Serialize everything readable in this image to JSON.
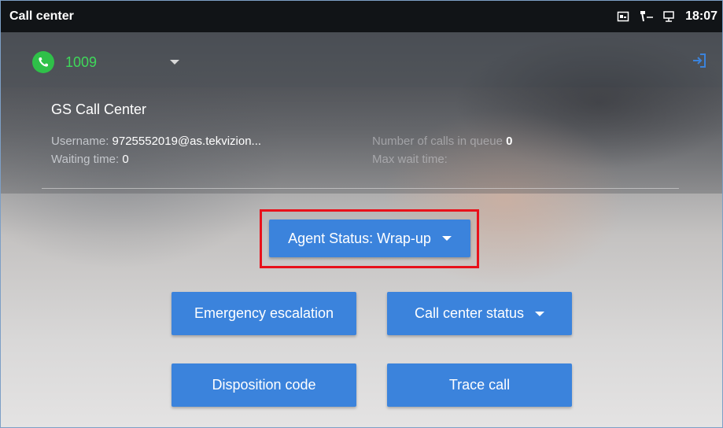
{
  "statusbar": {
    "title": "Call center",
    "time": "18:07",
    "icons": [
      "screenshot-icon",
      "usb-icon",
      "network-icon"
    ]
  },
  "header": {
    "line_number": "1009",
    "icons": [
      "phone-icon",
      "dropdown-icon",
      "exit-icon"
    ]
  },
  "panel": {
    "title": "GS Call Center",
    "username_label": "Username: ",
    "username_value": "9725552019@as.tekvizion...",
    "waiting_label": "Waiting time: ",
    "waiting_value": "0",
    "queue_label": "Number of calls in queue ",
    "queue_value": "0",
    "max_wait_label": "Max wait time:"
  },
  "buttons": {
    "agent_status": "Agent Status: Wrap-up",
    "emergency": "Emergency escalation",
    "call_center_status": "Call center status",
    "disposition": "Disposition code",
    "trace": "Trace call"
  },
  "colors": {
    "accent": "#3b83dc",
    "status_green": "#2fc149",
    "highlight": "#e8111a"
  }
}
